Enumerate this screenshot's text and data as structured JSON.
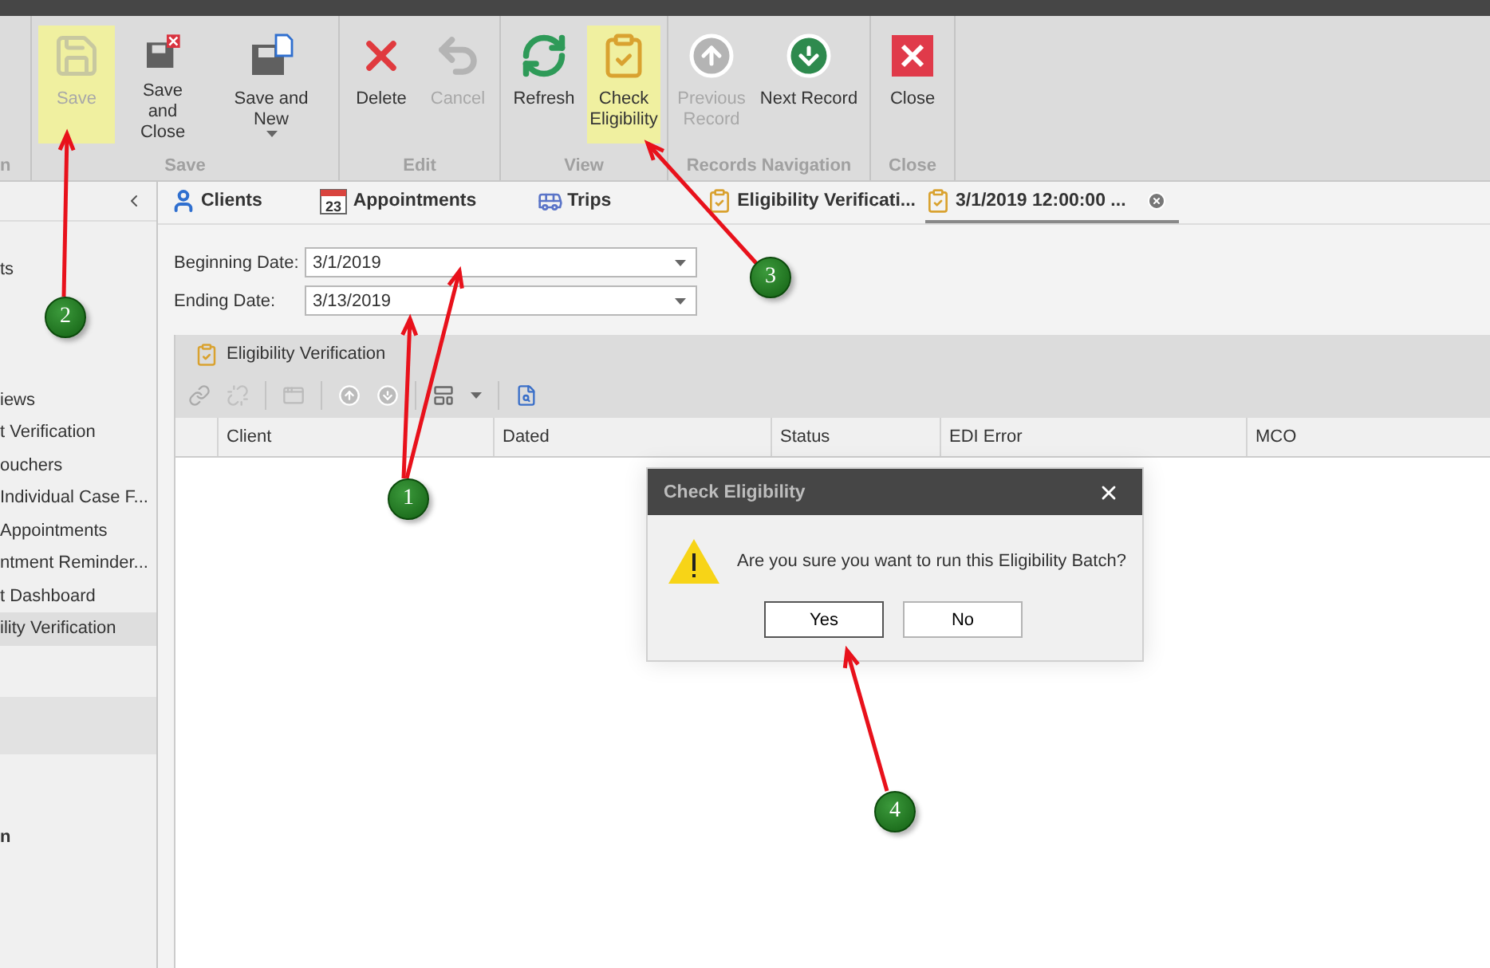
{
  "ribbon": {
    "groups": [
      {
        "label": "n"
      },
      {
        "label": "Save",
        "buttons": [
          {
            "kind": "save",
            "label": "Save",
            "disabled": true,
            "highlighted": true,
            "has_dropdown": false
          },
          {
            "kind": "save-close",
            "label": "Save and Close",
            "disabled": false,
            "highlighted": false,
            "has_dropdown": false
          },
          {
            "kind": "save-new",
            "label": "Save and New",
            "disabled": false,
            "highlighted": false,
            "has_dropdown": true
          }
        ]
      },
      {
        "label": "Edit",
        "buttons": [
          {
            "kind": "delete",
            "label": "Delete",
            "disabled": false,
            "highlighted": false,
            "has_dropdown": false
          },
          {
            "kind": "cancel",
            "label": "Cancel",
            "disabled": true,
            "highlighted": false,
            "has_dropdown": false
          }
        ]
      },
      {
        "label": "View",
        "buttons": [
          {
            "kind": "refresh",
            "label": "Refresh",
            "disabled": false,
            "highlighted": false,
            "has_dropdown": false
          },
          {
            "kind": "check",
            "label": "Check Eligibility",
            "disabled": false,
            "highlighted": true,
            "has_dropdown": false
          }
        ]
      },
      {
        "label": "Records Navigation",
        "buttons": [
          {
            "kind": "previous",
            "label": "Previous Record",
            "disabled": true,
            "highlighted": false,
            "has_dropdown": false
          },
          {
            "kind": "next",
            "label": "Next Record",
            "disabled": false,
            "highlighted": false,
            "has_dropdown": false
          }
        ]
      },
      {
        "label": "Close",
        "buttons": [
          {
            "kind": "close",
            "label": "Close",
            "disabled": false,
            "highlighted": false,
            "has_dropdown": false
          }
        ]
      }
    ]
  },
  "sidebar": {
    "items": [
      {
        "kind": "item",
        "label": "ts",
        "selected": false
      },
      {
        "kind": "gap"
      },
      {
        "kind": "item",
        "label": "iews",
        "selected": false
      },
      {
        "kind": "item",
        "label": "t Verification",
        "selected": false
      },
      {
        "kind": "item",
        "label": "ouchers",
        "selected": false
      },
      {
        "kind": "item",
        "label": "Individual Case F...",
        "selected": false
      },
      {
        "kind": "item",
        "label": "Appointments",
        "selected": false
      },
      {
        "kind": "item",
        "label": "ntment Reminder...",
        "selected": false
      },
      {
        "kind": "item",
        "label": "t Dashboard",
        "selected": false
      },
      {
        "kind": "item",
        "label": "ility Verification",
        "selected": true
      },
      {
        "kind": "band"
      },
      {
        "kind": "header",
        "label": "n"
      }
    ]
  },
  "tabs": [
    {
      "kind": "clients",
      "label": "Clients",
      "selected": false,
      "closable": false
    },
    {
      "kind": "calendar",
      "label": "Appointments",
      "selected": false,
      "closable": false
    },
    {
      "kind": "trips",
      "label": "Trips",
      "selected": false,
      "closable": false
    },
    {
      "kind": "clipboard",
      "label": "Eligibility Verificati...",
      "selected": false,
      "closable": false
    },
    {
      "kind": "clipboard",
      "label": "3/1/2019 12:00:00 ...",
      "selected": true,
      "closable": true
    }
  ],
  "calendar_icon_text": "23",
  "form": {
    "fields": [
      {
        "label": "Beginning Date:",
        "value": "3/1/2019"
      },
      {
        "label": "Ending Date:",
        "value": "3/13/2019"
      }
    ]
  },
  "grid": {
    "title": "Eligibility Verification",
    "columns": [
      "Client",
      "Dated",
      "Status",
      "EDI Error",
      "MCO"
    ]
  },
  "dialog": {
    "title": "Check Eligibility",
    "message": "Are you sure you want to run this Eligibility Batch?",
    "buttons": [
      {
        "label": "Yes",
        "default": true
      },
      {
        "label": "No",
        "default": false
      }
    ]
  },
  "annotations": [
    {
      "number": "1"
    },
    {
      "number": "2"
    },
    {
      "number": "3"
    },
    {
      "number": "4"
    }
  ]
}
